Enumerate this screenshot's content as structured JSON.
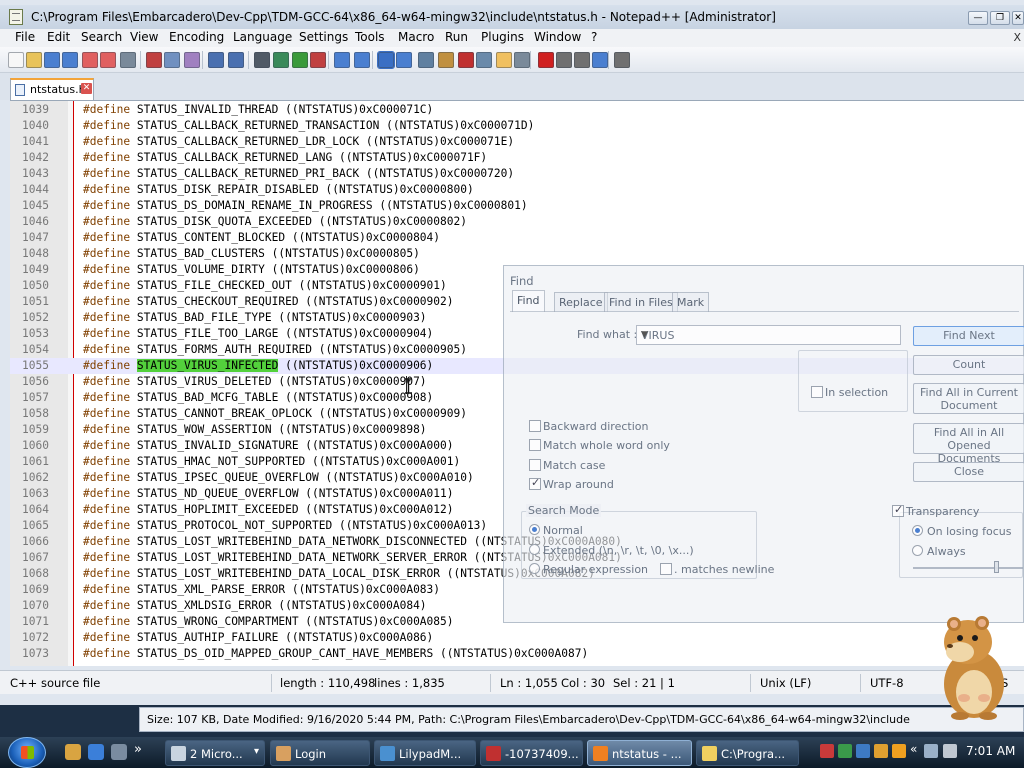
{
  "window": {
    "title": "C:\\Program Files\\Embarcadero\\Dev-Cpp\\TDM-GCC-64\\x86_64-w64-mingw32\\include\\ntstatus.h - Notepad++ [Administrator]",
    "minimize": "—",
    "maximize": "❐",
    "close": "✕"
  },
  "menu": [
    "File",
    "Edit",
    "Search",
    "View",
    "Encoding",
    "Language",
    "Settings",
    "Tools",
    "Macro",
    "Run",
    "Plugins",
    "Window",
    "?"
  ],
  "menu_close": "X",
  "toolbar_icons": [
    "new-file-icon",
    "open-file-icon",
    "save-icon",
    "save-all-icon",
    "close-icon",
    "close-all-icon",
    "print-icon",
    "cut-icon",
    "copy-icon",
    "paste-icon",
    "undo-icon",
    "redo-icon",
    "find-icon",
    "replace-icon",
    "zoom-in-icon",
    "zoom-out-icon",
    "sync-vertical-icon",
    "sync-horizontal-icon",
    "word-wrap-icon",
    "show-all-chars-icon",
    "indent-guide-icon",
    "udl-icon",
    "doc-map-icon",
    "function-list-icon",
    "folder-workspace-icon",
    "monitoring-icon",
    "record-macro-icon",
    "stop-macro-icon",
    "play-macro-icon",
    "run-macro-multiple-icon",
    "save-macro-icon"
  ],
  "tab": {
    "label": "ntstatus.h",
    "close": "✕"
  },
  "editor": {
    "lines": [
      {
        "n": "1039",
        "name": "STATUS_INVALID_THREAD",
        "val": "0xC000071C"
      },
      {
        "n": "1040",
        "name": "STATUS_CALLBACK_RETURNED_TRANSACTION",
        "val": "0xC000071D"
      },
      {
        "n": "1041",
        "name": "STATUS_CALLBACK_RETURNED_LDR_LOCK",
        "val": "0xC000071E"
      },
      {
        "n": "1042",
        "name": "STATUS_CALLBACK_RETURNED_LANG",
        "val": "0xC000071F"
      },
      {
        "n": "1043",
        "name": "STATUS_CALLBACK_RETURNED_PRI_BACK",
        "val": "0xC0000720"
      },
      {
        "n": "1044",
        "name": "STATUS_DISK_REPAIR_DISABLED",
        "val": "0xC0000800"
      },
      {
        "n": "1045",
        "name": "STATUS_DS_DOMAIN_RENAME_IN_PROGRESS",
        "val": "0xC0000801"
      },
      {
        "n": "1046",
        "name": "STATUS_DISK_QUOTA_EXCEEDED",
        "val": "0xC0000802"
      },
      {
        "n": "1047",
        "name": "STATUS_CONTENT_BLOCKED",
        "val": "0xC0000804"
      },
      {
        "n": "1048",
        "name": "STATUS_BAD_CLUSTERS",
        "val": "0xC0000805"
      },
      {
        "n": "1049",
        "name": "STATUS_VOLUME_DIRTY",
        "val": "0xC0000806"
      },
      {
        "n": "1050",
        "name": "STATUS_FILE_CHECKED_OUT",
        "val": "0xC0000901"
      },
      {
        "n": "1051",
        "name": "STATUS_CHECKOUT_REQUIRED",
        "val": "0xC0000902"
      },
      {
        "n": "1052",
        "name": "STATUS_BAD_FILE_TYPE",
        "val": "0xC0000903"
      },
      {
        "n": "1053",
        "name": "STATUS_FILE_TOO_LARGE",
        "val": "0xC0000904"
      },
      {
        "n": "1054",
        "name": "STATUS_FORMS_AUTH_REQUIRED",
        "val": "0xC0000905"
      },
      {
        "n": "1055",
        "name": "STATUS_VIRUS_INFECTED",
        "val": "0xC0000906"
      },
      {
        "n": "1056",
        "name": "STATUS_VIRUS_DELETED",
        "val": "0xC0000907"
      },
      {
        "n": "1057",
        "name": "STATUS_BAD_MCFG_TABLE",
        "val": "0xC0000908"
      },
      {
        "n": "1058",
        "name": "STATUS_CANNOT_BREAK_OPLOCK",
        "val": "0xC0000909"
      },
      {
        "n": "1059",
        "name": "STATUS_WOW_ASSERTION",
        "val": "0xC0009898"
      },
      {
        "n": "1060",
        "name": "STATUS_INVALID_SIGNATURE",
        "val": "0xC000A000"
      },
      {
        "n": "1061",
        "name": "STATUS_HMAC_NOT_SUPPORTED",
        "val": "0xC000A001"
      },
      {
        "n": "1062",
        "name": "STATUS_IPSEC_QUEUE_OVERFLOW",
        "val": "0xC000A010"
      },
      {
        "n": "1063",
        "name": "STATUS_ND_QUEUE_OVERFLOW",
        "val": "0xC000A011"
      },
      {
        "n": "1064",
        "name": "STATUS_HOPLIMIT_EXCEEDED",
        "val": "0xC000A012"
      },
      {
        "n": "1065",
        "name": "STATUS_PROTOCOL_NOT_SUPPORTED",
        "val": "0xC000A013"
      },
      {
        "n": "1066",
        "name": "STATUS_LOST_WRITEBEHIND_DATA_NETWORK_DISCONNECTED",
        "val": "0xC000A080"
      },
      {
        "n": "1067",
        "name": "STATUS_LOST_WRITEBEHIND_DATA_NETWORK_SERVER_ERROR",
        "val": "0xC000A081"
      },
      {
        "n": "1068",
        "name": "STATUS_LOST_WRITEBEHIND_DATA_LOCAL_DISK_ERROR",
        "val": "0xC000A082"
      },
      {
        "n": "1069",
        "name": "STATUS_XML_PARSE_ERROR",
        "val": "0xC000A083"
      },
      {
        "n": "1070",
        "name": "STATUS_XMLDSIG_ERROR",
        "val": "0xC000A084"
      },
      {
        "n": "1071",
        "name": "STATUS_WRONG_COMPARTMENT",
        "val": "0xC000A085"
      },
      {
        "n": "1072",
        "name": "STATUS_AUTHIP_FAILURE",
        "val": "0xC000A086"
      },
      {
        "n": "1073",
        "name": "STATUS_DS_OID_MAPPED_GROUP_CANT_HAVE_MEMBERS",
        "val": "0xC000A087"
      }
    ],
    "define_kw": "#define",
    "cast": "NTSTATUS",
    "current_line": "1055",
    "highlight_color": "#53d13c"
  },
  "status": {
    "type": "C++ source file",
    "length": "length : 110,498",
    "lines": "lines : 1,835",
    "ln": "Ln : 1,055",
    "col": "Col : 30",
    "sel": "Sel : 21 | 1",
    "eol": "Unix (LF)",
    "enc": "UTF-8",
    "ins": "S"
  },
  "explorer_details": "Size: 107 KB, Date Modified: 9/16/2020 5:44 PM, Path: C:\\Program Files\\Embarcadero\\Dev-Cpp\\TDM-GCC-64\\x86_64-w64-mingw32\\include",
  "taskbar": {
    "tasks": [
      {
        "label": "2 Micro...",
        "icon": "window-stack-icon"
      },
      {
        "label": "Login",
        "icon": "user-icon"
      },
      {
        "label": "LilypadM...",
        "icon": "mail-icon"
      },
      {
        "label": "-10737409...",
        "icon": "process-icon"
      },
      {
        "label": "ntstatus - ...",
        "icon": "notepad-icon"
      },
      {
        "label": "C:\\Progra...",
        "icon": "folder-icon"
      }
    ],
    "clock": "7:01 AM",
    "quicklaunch_more": "»",
    "tray_more": "«"
  },
  "find": {
    "title": "Find",
    "tabs": [
      "Find",
      "Replace",
      "Find in Files",
      "Mark"
    ],
    "find_what_label": "Find what :",
    "find_what_value": "VIRUS",
    "buttons": {
      "find_next": "Find Next",
      "count": "Count",
      "find_all_current_1": "Find All in Current",
      "find_all_current_2": "Document",
      "find_all_opened_1": "Find All in All Opened",
      "find_all_opened_2": "Documents",
      "close": "Close"
    },
    "in_selection": "In selection",
    "backward": "Backward direction",
    "whole_word": "Match whole word only",
    "match_case": "Match case",
    "wrap_around": "Wrap around",
    "search_mode": "Search Mode",
    "normal": "Normal",
    "extended": "Extended (\\n, \\r, \\t, \\0, \\x...)",
    "regex": "Regular expression",
    "matches_newline": ". matches newline",
    "transparency": "Transparency",
    "on_losing_focus": "On losing focus",
    "always": "Always",
    "wrap_around_checked": true,
    "transparency_checked": true,
    "mode_selected": "Normal",
    "transparency_selected": "On losing focus",
    "transparency_level": 0.8
  }
}
